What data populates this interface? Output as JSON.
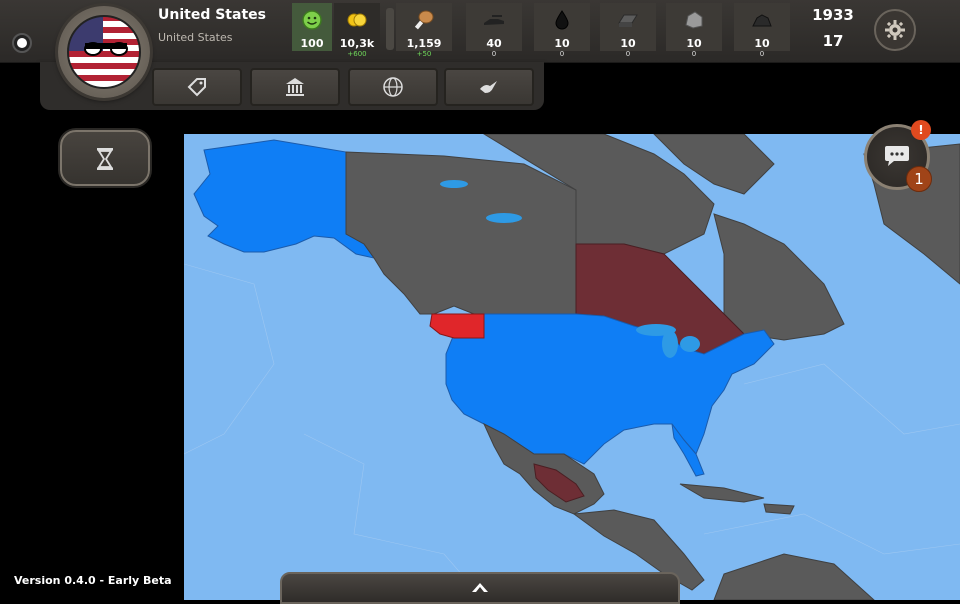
{
  "player": {
    "country_name": "United States",
    "country_subtitle": "United States"
  },
  "resources": [
    {
      "id": "happiness",
      "icon": "smiley-icon",
      "value": "100",
      "delta": ""
    },
    {
      "id": "gold",
      "icon": "gold-coins-icon",
      "value": "10,3k",
      "delta": "+600"
    },
    {
      "id": "food",
      "icon": "food-drumstick-icon",
      "value": "1,159",
      "delta": "+50"
    },
    {
      "id": "military",
      "icon": "military-units-icon",
      "value": "40",
      "delta": "0"
    },
    {
      "id": "oil",
      "icon": "oil-drop-icon",
      "value": "10",
      "delta": "0"
    },
    {
      "id": "steel",
      "icon": "steel-ingot-icon",
      "value": "10",
      "delta": "0"
    },
    {
      "id": "stone",
      "icon": "stone-icon",
      "value": "10",
      "delta": "0"
    },
    {
      "id": "coal",
      "icon": "coal-icon",
      "value": "10",
      "delta": "0"
    }
  ],
  "date": {
    "year": "1933",
    "turn": "17"
  },
  "menu_buttons": [
    "tag-icon",
    "government-building-icon",
    "globe-emblem-icon",
    "peace-dove-icon"
  ],
  "chat": {
    "alert": "!",
    "count": "1"
  },
  "version": "Version 0.4.0 - Early Beta",
  "colors": {
    "ocean": "#7fb9f2",
    "player": "#0f7ef5",
    "land": "#5a5a5a",
    "enemy_dark": "#6e2e35",
    "enemy_red": "#e0262a"
  }
}
